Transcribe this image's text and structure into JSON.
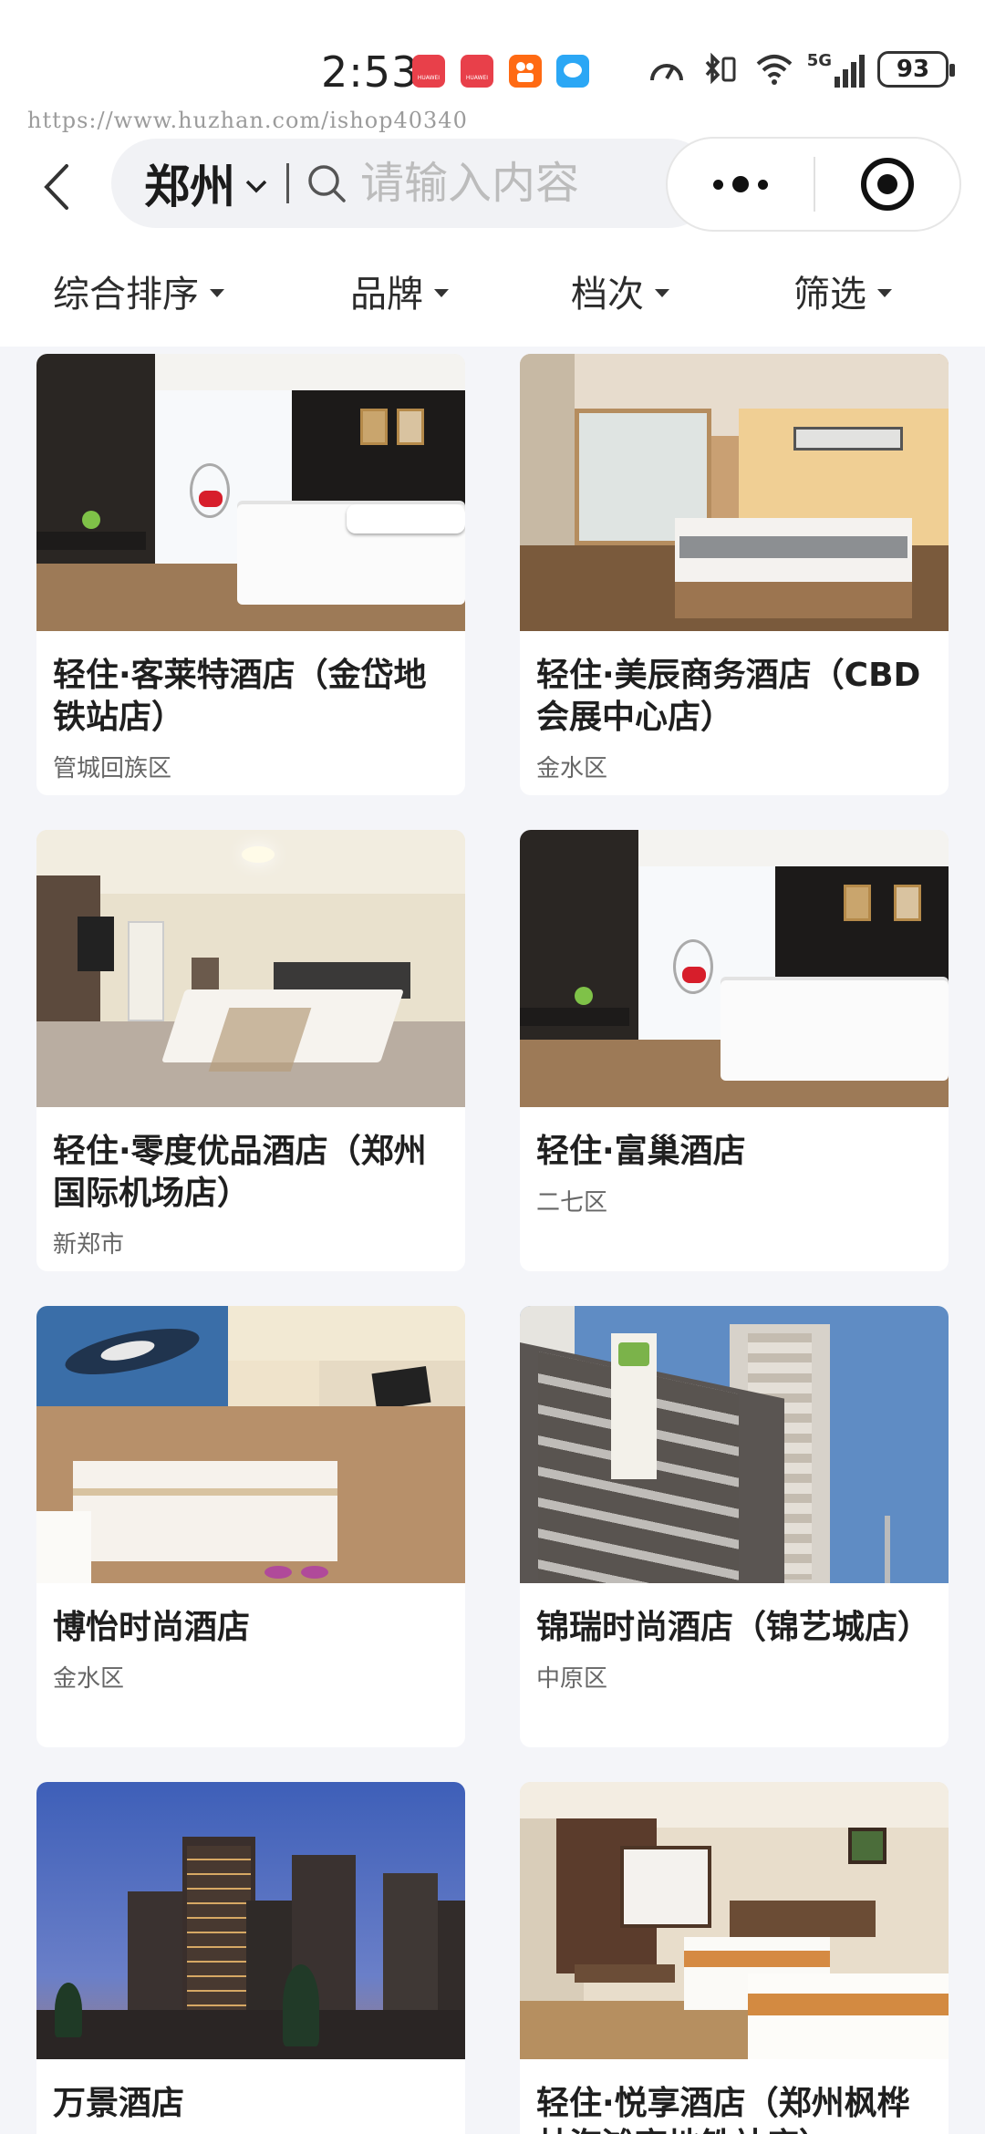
{
  "status": {
    "time": "2:53",
    "battery": "93",
    "network": "5G"
  },
  "watermark": "https://www.huzhan.com/ishop40340",
  "nav": {
    "city": "郑州",
    "search_placeholder": "请输入内容"
  },
  "filters": [
    {
      "label": "综合排序"
    },
    {
      "label": "品牌"
    },
    {
      "label": "档次"
    },
    {
      "label": "筛选"
    }
  ],
  "hotels": [
    {
      "name": "轻住·客莱特酒店（金岱地铁站店）",
      "district": "管城回族区"
    },
    {
      "name": "轻住·美辰商务酒店（CBD会展中心店）",
      "district": "金水区"
    },
    {
      "name": "轻住·零度优品酒店（郑州国际机场店）",
      "district": "新郑市"
    },
    {
      "name": "轻住·富巢酒店",
      "district": "二七区"
    },
    {
      "name": "博怡时尚酒店",
      "district": "金水区"
    },
    {
      "name": "锦瑞时尚酒店（锦艺城店）",
      "district": "中原区"
    },
    {
      "name": "万景酒店",
      "district": ""
    },
    {
      "name": "轻住·悦享酒店（郑州枫桦林海滩商地铁站店）",
      "district": ""
    }
  ],
  "colors": {
    "page_bg": "#f4f5f9",
    "card_bg": "#ffffff",
    "title_text": "#1f1f1f",
    "sub_text": "#666666"
  }
}
